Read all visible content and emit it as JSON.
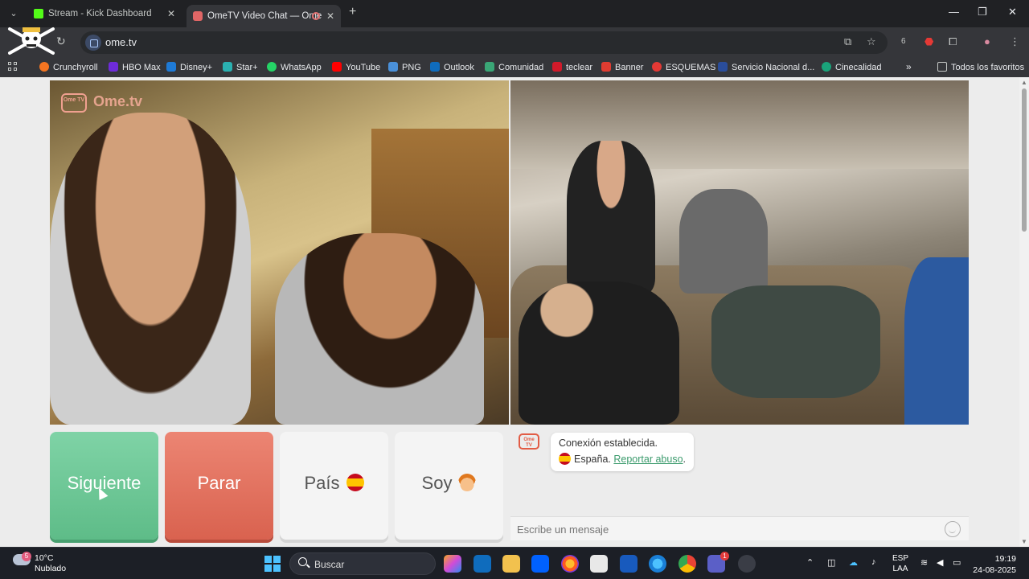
{
  "browser": {
    "tabs": [
      {
        "title": "Stream - Kick Dashboard"
      },
      {
        "title": "OmeTV Video Chat — Ome"
      }
    ],
    "url": "ome.tv",
    "extension_badge": "6",
    "bookmarks": [
      {
        "label": "Crunchyroll",
        "color": "#f47521"
      },
      {
        "label": "HBO Max",
        "color": "#6e2bd9"
      },
      {
        "label": "Disney+",
        "color": "#1e7ad6"
      },
      {
        "label": "Star+",
        "color": "#2ab0b0"
      },
      {
        "label": "WhatsApp",
        "color": "#25d366"
      },
      {
        "label": "YouTube",
        "color": "#ff0000"
      },
      {
        "label": "PNG",
        "color": "#4a90d9"
      },
      {
        "label": "Outlook",
        "color": "#0f6cbd"
      },
      {
        "label": "Comunidad",
        "color": "#3aa676"
      },
      {
        "label": "teclear",
        "color": "#d11a2a"
      },
      {
        "label": "Banner",
        "color": "#e03c31"
      },
      {
        "label": "ESQUEMAS",
        "color": "#e53935"
      },
      {
        "label": "Servicio Nacional d...",
        "color": "#2a4d9b"
      },
      {
        "label": "Cinecalidad",
        "color": "#1aa37a"
      }
    ],
    "all_bookmarks": "Todos los favoritos"
  },
  "ome": {
    "logo_box": "Ome TV",
    "logo_text": "Ome.tv",
    "buttons": {
      "next": "Siguiente",
      "stop": "Parar",
      "country": "País",
      "gender": "Soy"
    },
    "chat": {
      "connected": "Conexión establecida.",
      "country": "España.",
      "report": "Reportar abuso",
      "report_suffix": ".",
      "placeholder": "Escribe un mensaje"
    }
  },
  "taskbar": {
    "weather_badge": "5",
    "temperature": "10°C",
    "weather": "Nublado",
    "search": "Buscar",
    "teams_badge": "1",
    "lang_top": "ESP",
    "lang_bottom": "LAA",
    "time": "19:19",
    "date": "24-08-2025"
  }
}
